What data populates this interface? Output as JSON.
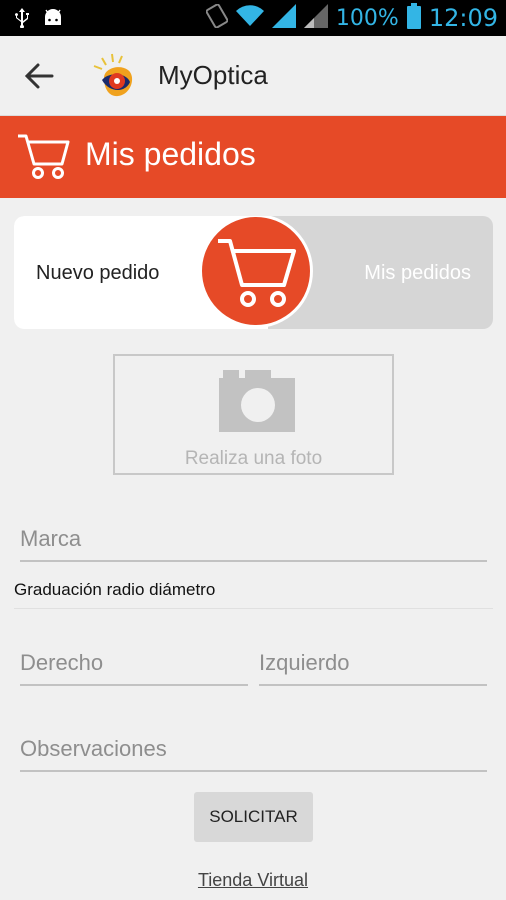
{
  "status_bar": {
    "battery": "100%",
    "time": "12:09",
    "icons": [
      "usb-icon",
      "android-icon",
      "sync-icon",
      "wifi-icon",
      "signal-icon",
      "signal-weak-icon",
      "battery-icon"
    ]
  },
  "action_bar": {
    "title": "MyOptica",
    "back_icon": "back-arrow-icon",
    "logo_icon": "myoptica-logo-icon"
  },
  "header": {
    "title": "Mis pedidos",
    "icon": "cart-icon",
    "color": "#e64a27"
  },
  "toggle": {
    "left_label": "Nuevo pedido",
    "right_label": "Mis pedidos"
  },
  "photo": {
    "label": "Realiza una foto",
    "icon": "camera-icon"
  },
  "form": {
    "marca_placeholder": "Marca",
    "section_label": "Graduación radio diámetro",
    "derecho_placeholder": "Derecho",
    "izquierdo_placeholder": "Izquierdo",
    "observaciones_placeholder": "Observaciones",
    "submit_label": "SOLICITAR",
    "store_link": "Tienda Virtual"
  }
}
